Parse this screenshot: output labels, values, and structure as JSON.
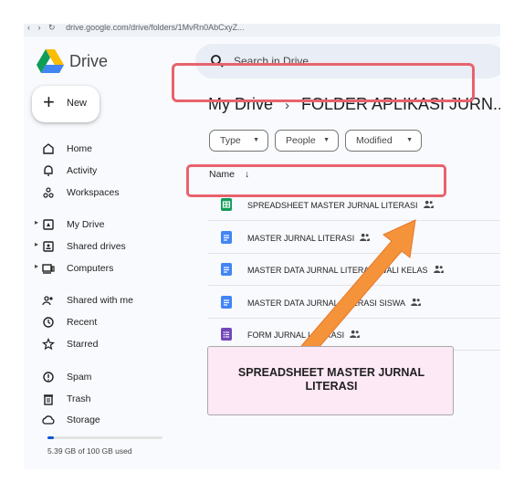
{
  "browser": {
    "url": "drive.google.com/drive/folders/1MvRn0AbCxyZ..."
  },
  "app": {
    "name": "Drive"
  },
  "search": {
    "placeholder": "Search in Drive"
  },
  "new_button": {
    "label": "New"
  },
  "nav": [
    {
      "label": "Home",
      "icon": "home-icon"
    },
    {
      "label": "Activity",
      "icon": "bell-icon"
    },
    {
      "label": "Workspaces",
      "icon": "workspaces-icon"
    },
    {
      "label": "My Drive",
      "icon": "my-drive-icon",
      "expandable": true
    },
    {
      "label": "Shared drives",
      "icon": "shared-drives-icon",
      "expandable": true
    },
    {
      "label": "Computers",
      "icon": "computers-icon",
      "expandable": true
    },
    {
      "label": "Shared with me",
      "icon": "people-icon"
    },
    {
      "label": "Recent",
      "icon": "clock-icon"
    },
    {
      "label": "Starred",
      "icon": "star-icon"
    },
    {
      "label": "Spam",
      "icon": "spam-icon"
    },
    {
      "label": "Trash",
      "icon": "trash-icon"
    },
    {
      "label": "Storage",
      "icon": "cloud-icon"
    }
  ],
  "storage": {
    "used_text": "5.39 GB of 100 GB used",
    "used_fraction": 0.054
  },
  "breadcrumb": {
    "root": "My Drive",
    "separator": "›",
    "current": "FOLDER APLIKASI JURN..."
  },
  "filters": [
    {
      "label": "Type"
    },
    {
      "label": "People"
    },
    {
      "label": "Modified"
    }
  ],
  "list": {
    "column_name": "Name",
    "sort_icon": "arrow-down-icon",
    "files": [
      {
        "name": "SPREADSHEET MASTER  JURNAL LITERASI",
        "type": "sheets",
        "color": "#0f9d58",
        "shared": true
      },
      {
        "name": "MASTER JURNAL LITERASI",
        "type": "docs",
        "color": "#4285f4",
        "shared": true
      },
      {
        "name": "MASTER DATA JURNAL LITERASI WALI KELAS",
        "type": "docs",
        "color": "#4285f4",
        "shared": true
      },
      {
        "name": "MASTER DATA JURNAL LITERASI SISWA",
        "type": "docs",
        "color": "#4285f4",
        "shared": true
      },
      {
        "name": "FORM  JURNAL LITERASI",
        "type": "forms",
        "color": "#7248b9",
        "shared": true
      }
    ]
  },
  "annotation": {
    "callout_text": "SPREADSHEET  MASTER JURNAL LITERASI",
    "highlight_color": "#e8626d",
    "arrow_color": "#f4933a",
    "callout_bg": "#fde8f5"
  }
}
